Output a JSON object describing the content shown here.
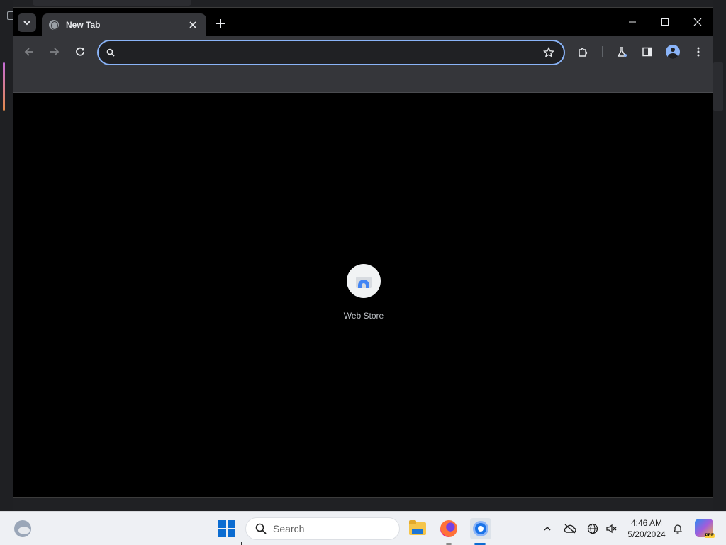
{
  "browser": {
    "tab": {
      "title": "New Tab"
    },
    "omnibox": {
      "value": "",
      "placeholder": ""
    },
    "new_tab_page": {
      "shortcuts": [
        {
          "label": "Web Store"
        }
      ]
    }
  },
  "taskbar": {
    "search_label": "Search",
    "clock": {
      "time": "4:46 AM",
      "date": "5/20/2024"
    }
  },
  "colors": {
    "accent": "#8ab4f8",
    "toolbar_bg": "#35363a",
    "page_bg": "#000000",
    "taskbar_bg": "#eef0f4",
    "windows_blue": "#0b6cd1"
  }
}
